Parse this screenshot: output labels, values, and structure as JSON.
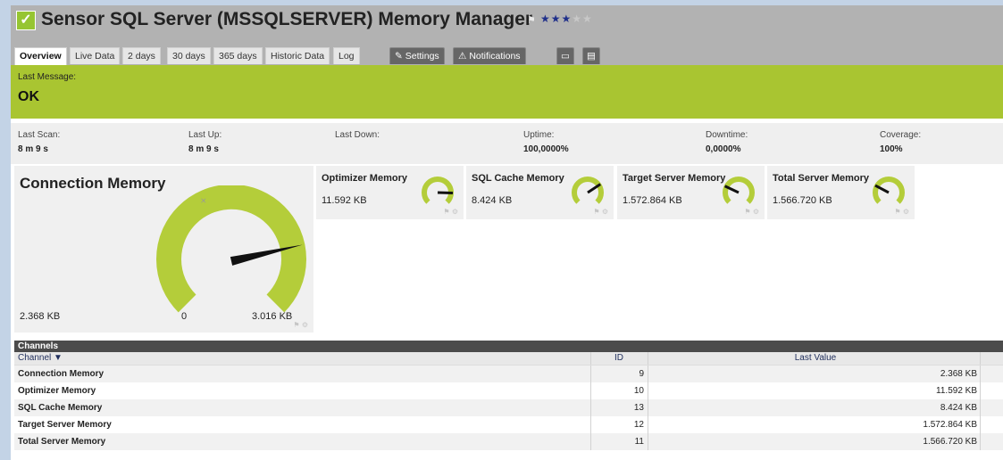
{
  "header": {
    "title": "Sensor SQL Server (MSSQLSERVER) Memory Manager",
    "priority_on": "★★★",
    "priority_off": "★★",
    "check_glyph": "✓",
    "flag_glyph": "⚑"
  },
  "tabs": [
    {
      "label": "Overview",
      "active": true
    },
    {
      "label": "Live Data"
    },
    {
      "label": "2 days"
    },
    {
      "label": "30 days"
    },
    {
      "label": "365 days"
    },
    {
      "label": "Historic Data"
    },
    {
      "label": "Log"
    },
    {
      "label": "Settings",
      "icon": "wrench-icon"
    },
    {
      "label": "Notifications",
      "icon": "warning-icon"
    },
    {
      "label": "",
      "icon": "comment-icon"
    },
    {
      "label": "",
      "icon": "history-icon"
    }
  ],
  "last_message": {
    "label": "Last Message:",
    "value": "OK"
  },
  "stats": {
    "last_scan": {
      "label": "Last Scan:",
      "value": "8 m 9 s"
    },
    "last_up": {
      "label": "Last Up:",
      "value": "8 m 9 s"
    },
    "last_down": {
      "label": "Last Down:",
      "value": ""
    },
    "uptime": {
      "label": "Uptime:",
      "value": "100,0000%"
    },
    "downtime": {
      "label": "Downtime:",
      "value": "0,0000%"
    },
    "coverage": {
      "label": "Coverage:",
      "value": "100%"
    }
  },
  "primary_gauge": {
    "name": "Connection Memory",
    "value": "2.368 KB",
    "min": "0",
    "max": "3.016 KB",
    "level": 0.785
  },
  "gauges": [
    {
      "name": "Optimizer Memory",
      "value": "11.592 KB",
      "level": 0.84
    },
    {
      "name": "SQL Cache Memory",
      "value": "8.424 KB",
      "level": 0.71
    },
    {
      "name": "Target Server Memory",
      "value": "1.572.864 KB",
      "level": 0.26
    },
    {
      "name": "Total Server Memory",
      "value": "1.566.720 KB",
      "level": 0.27
    }
  ],
  "channels": {
    "title": "Channels",
    "headers": {
      "channel": "Channel ▼",
      "id": "ID",
      "last_value": "Last Value"
    },
    "rows": [
      {
        "channel": "Connection Memory",
        "id": "9",
        "last_value": "2.368 KB"
      },
      {
        "channel": "Optimizer Memory",
        "id": "10",
        "last_value": "11.592 KB"
      },
      {
        "channel": "SQL Cache Memory",
        "id": "13",
        "last_value": "8.424 KB"
      },
      {
        "channel": "Target Server Memory",
        "id": "12",
        "last_value": "1.572.864 KB"
      },
      {
        "channel": "Total Server Memory",
        "id": "11",
        "last_value": "1.566.720 KB"
      }
    ]
  },
  "colors": {
    "ok_green": "#a9c531",
    "gauge_green": "#b4cd3a",
    "header_gray": "#b2b2b2",
    "priority_blue": "#1f2f8a"
  }
}
